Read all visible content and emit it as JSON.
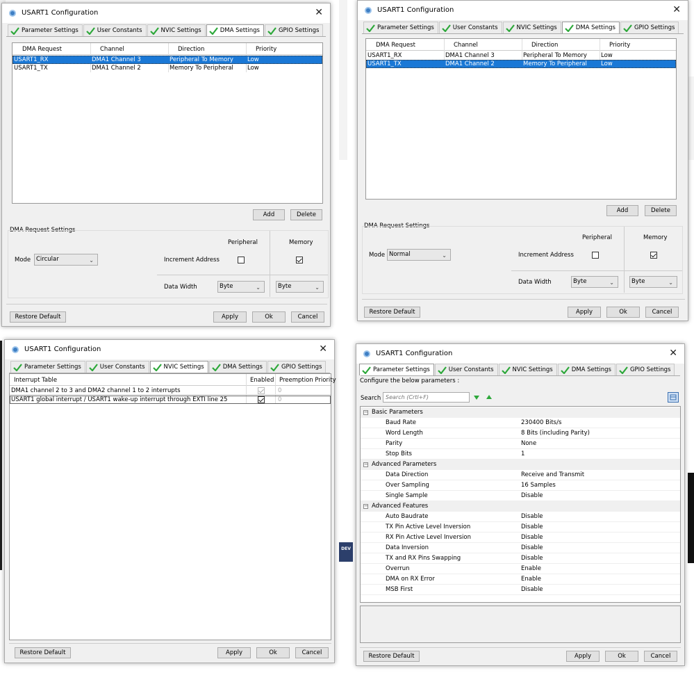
{
  "colors": {
    "selection": "#1a78d6",
    "check_green": "#2da83a",
    "window_bg": "#f0f0f0",
    "logo_bg": "#2c3f6b"
  },
  "dialog_title": "USART1 Configuration",
  "tabs": [
    "Parameter Settings",
    "User Constants",
    "NVIC Settings",
    "DMA Settings",
    "GPIO Settings"
  ],
  "buttons": {
    "add": "Add",
    "delete": "Delete",
    "restore": "Restore Default",
    "apply": "Apply",
    "ok": "Ok",
    "cancel": "Cancel"
  },
  "dma_headers": [
    "DMA Request",
    "Channel",
    "Direction",
    "Priority"
  ],
  "dma_rows": [
    [
      "USART1_RX",
      "DMA1 Channel 3",
      "Peripheral To Memory",
      "Low"
    ],
    [
      "USART1_TX",
      "DMA1 Channel 2",
      "Memory To Peripheral",
      "Low"
    ]
  ],
  "dma_settings": {
    "group_title": "DMA Request Settings",
    "peripheral": "Peripheral",
    "memory": "Memory",
    "mode_label": "Mode",
    "increment_label": "Increment Address",
    "width_label": "Data Width",
    "width_value": "Byte"
  },
  "win1": {
    "selected_row": 0,
    "mode": "Circular",
    "periph_increment": false,
    "mem_increment": true
  },
  "win2": {
    "selected_row": 1,
    "mode": "Normal",
    "periph_increment": false,
    "mem_increment": true
  },
  "nvic": {
    "headers": [
      "Interrupt Table",
      "Enabled",
      "Preemption Priority"
    ],
    "rows": [
      {
        "name": "DMA1 channel 2 to 3 and DMA2 channel 1 to 2 interrupts",
        "enabled": true,
        "disabled": true,
        "priority": "0"
      },
      {
        "name": "USART1 global interrupt / USART1 wake-up interrupt through EXTI line 25",
        "enabled": true,
        "disabled": false,
        "priority": "0"
      }
    ]
  },
  "params": {
    "intro": "Configure the below parameters :",
    "search_label": "Search :",
    "search_placeholder": "Search (Crtl+F)",
    "groups": [
      {
        "name": "Basic Parameters",
        "items": [
          [
            "Baud Rate",
            "230400 Bits/s"
          ],
          [
            "Word Length",
            "8 Bits (including Parity)"
          ],
          [
            "Parity",
            "None"
          ],
          [
            "Stop Bits",
            "1"
          ]
        ]
      },
      {
        "name": "Advanced Parameters",
        "items": [
          [
            "Data Direction",
            "Receive and Transmit"
          ],
          [
            "Over Sampling",
            "16 Samples"
          ],
          [
            "Single Sample",
            "Disable"
          ]
        ]
      },
      {
        "name": "Advanced Features",
        "items": [
          [
            "Auto Baudrate",
            "Disable"
          ],
          [
            "TX Pin Active Level Inversion",
            "Disable"
          ],
          [
            "RX Pin Active Level Inversion",
            "Disable"
          ],
          [
            "Data Inversion",
            "Disable"
          ],
          [
            "TX and RX Pins Swapping",
            "Disable"
          ],
          [
            "Overrun",
            "Enable"
          ],
          [
            "DMA on RX Error",
            "Enable"
          ],
          [
            "MSB First",
            "Disable"
          ]
        ]
      }
    ]
  },
  "logo_text": "DEV"
}
